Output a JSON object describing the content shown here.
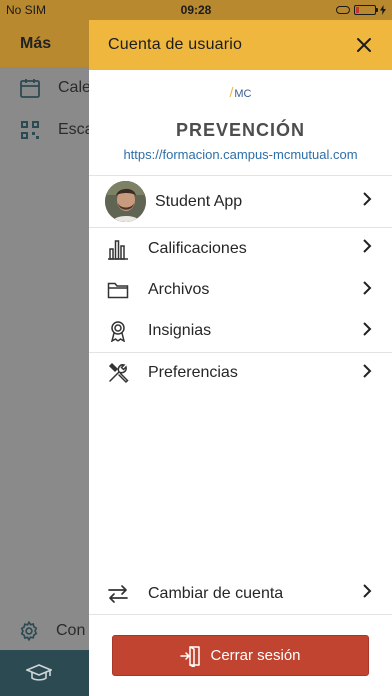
{
  "status_bar": {
    "carrier": "No SIM",
    "time": "09:28"
  },
  "background": {
    "header_title": "Más",
    "items": [
      {
        "label": "Cale",
        "icon": "calendar-icon"
      },
      {
        "label": "Esca",
        "icon": "qr-code-icon"
      }
    ],
    "bottom_item": {
      "label": "Con",
      "icon": "gear-icon"
    },
    "tabbar_icon": "graduation-cap-icon"
  },
  "drawer": {
    "title": "Cuenta de usuario",
    "logo_text": "MC",
    "site_name": "PREVENCIÓN",
    "site_url": "https://formacion.campus-mcmutual.com",
    "user": {
      "name": "Student App"
    },
    "menu": [
      {
        "label": "Calificaciones",
        "icon": "bar-chart-icon"
      },
      {
        "label": "Archivos",
        "icon": "folder-icon"
      },
      {
        "label": "Insignias",
        "icon": "badge-icon"
      },
      {
        "label": "Preferencias",
        "icon": "tools-icon"
      }
    ],
    "switch_account": {
      "label": "Cambiar de cuenta",
      "icon": "swap-icon"
    },
    "logout": {
      "label": "Cerrar sesión",
      "icon": "logout-icon"
    }
  },
  "colors": {
    "header_yellow": "#f0b73e",
    "logout_red": "#c0442f",
    "link_blue": "#2e6fa8",
    "tabbar_teal": "#2c4a52"
  }
}
